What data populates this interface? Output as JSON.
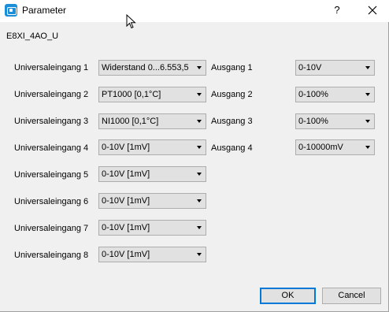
{
  "window": {
    "title": "Parameter",
    "help_label": "?"
  },
  "device_name": "E8XI_4AO_U",
  "inputs": [
    {
      "label": "Universaleingang 1",
      "value": "Widerstand 0...6.553,5"
    },
    {
      "label": "Universaleingang 2",
      "value": "PT1000 [0,1°C]"
    },
    {
      "label": "Universaleingang 3",
      "value": "NI1000 [0,1°C]"
    },
    {
      "label": "Universaleingang 4",
      "value": "0-10V [1mV]"
    },
    {
      "label": "Universaleingang 5",
      "value": "0-10V [1mV]"
    },
    {
      "label": "Universaleingang 6",
      "value": "0-10V [1mV]"
    },
    {
      "label": "Universaleingang 7",
      "value": "0-10V [1mV]"
    },
    {
      "label": "Universaleingang 8",
      "value": "0-10V [1mV]"
    }
  ],
  "outputs": [
    {
      "label": "Ausgang 1",
      "value": "0-10V"
    },
    {
      "label": "Ausgang 2",
      "value": "0-100%"
    },
    {
      "label": "Ausgang 3",
      "value": "0-100%"
    },
    {
      "label": "Ausgang 4",
      "value": "0-10000mV"
    }
  ],
  "buttons": {
    "ok": "OK",
    "cancel": "Cancel"
  }
}
